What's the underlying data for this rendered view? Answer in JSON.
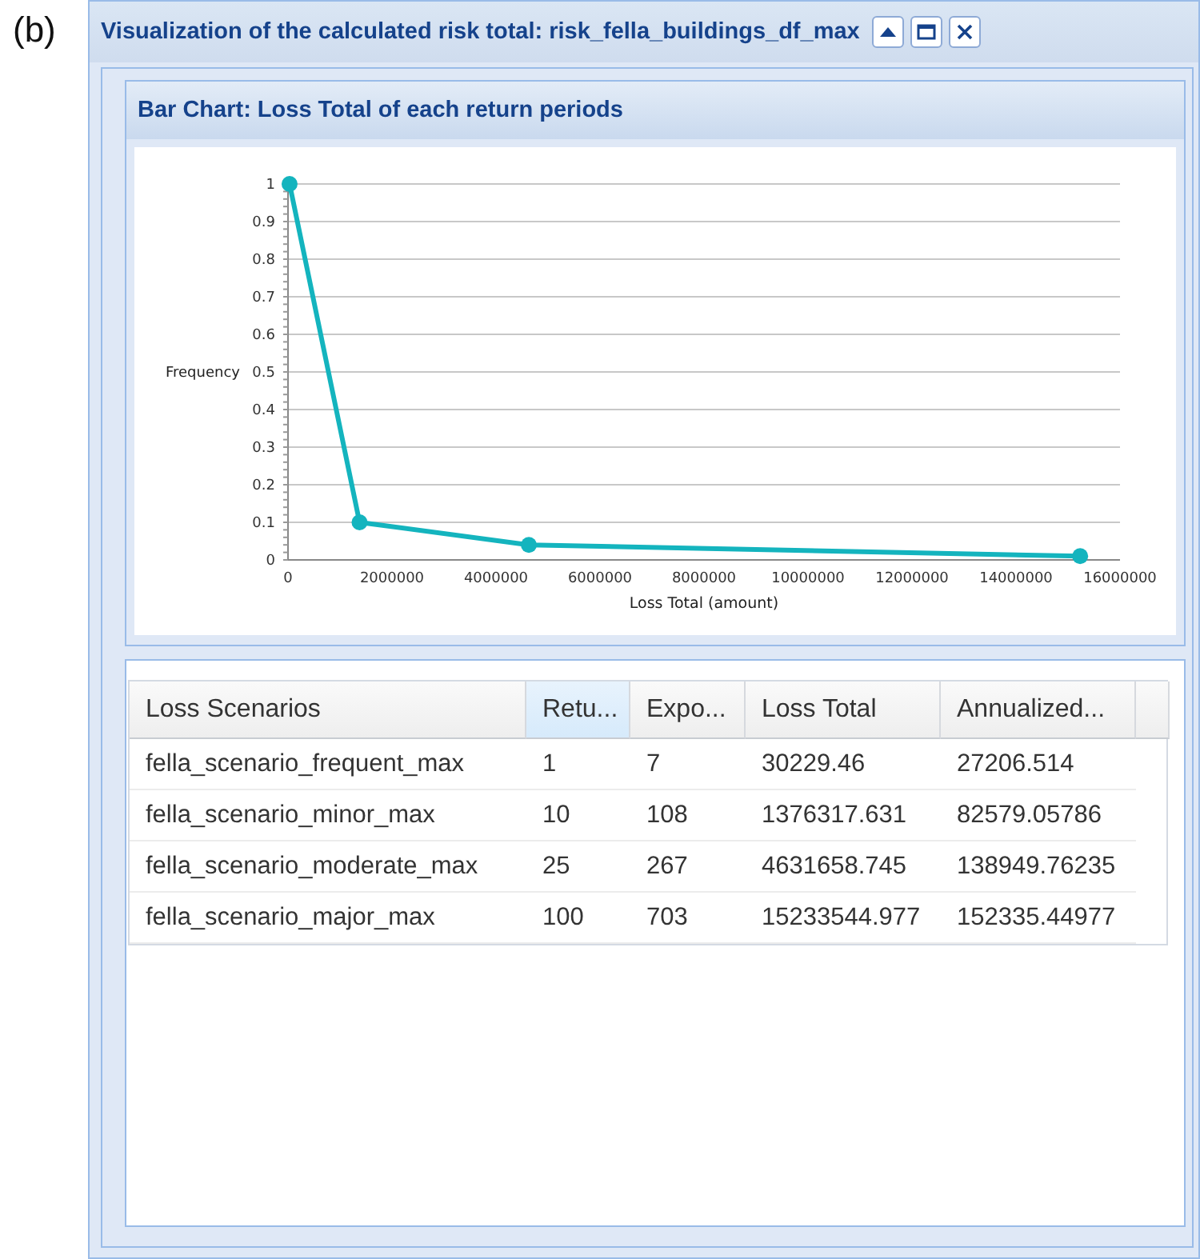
{
  "figure_label": "(b)",
  "window": {
    "title": "Visualization of the calculated risk total: risk_fella_buildings_df_max"
  },
  "chart_panel": {
    "title": "Bar Chart: Loss Total of each return periods",
    "chart_data": {
      "type": "line",
      "xlabel": "Loss Total (amount)",
      "ylabel": "Frequency",
      "x": [
        30229.46,
        1376317.631,
        4631658.745,
        15233544.977
      ],
      "series": [
        {
          "color": "#14b4be",
          "marker": true,
          "values": [
            1,
            0.1,
            0.04,
            0.01
          ]
        }
      ],
      "grid": true,
      "xlim": [
        0,
        16000000
      ],
      "ylim": [
        0,
        1
      ],
      "xticks": [
        0,
        2000000,
        4000000,
        6000000,
        8000000,
        10000000,
        12000000,
        14000000,
        16000000
      ],
      "yticks": [
        0,
        0.1,
        0.2,
        0.3,
        0.4,
        0.5,
        0.6,
        0.7,
        0.8,
        0.9,
        1
      ]
    }
  },
  "table": {
    "columns": [
      {
        "label": "Loss Scenarios",
        "selected": false
      },
      {
        "label": "Retu...",
        "selected": true
      },
      {
        "label": "Expo...",
        "selected": false
      },
      {
        "label": "Loss Total",
        "selected": false
      },
      {
        "label": "Annualized...",
        "selected": false
      }
    ],
    "rows": [
      [
        "fella_scenario_frequent_max",
        "1",
        "7",
        "30229.46",
        "27206.514"
      ],
      [
        "fella_scenario_minor_max",
        "10",
        "108",
        "1376317.631",
        "82579.05786"
      ],
      [
        "fella_scenario_moderate_max",
        "25",
        "267",
        "4631658.745",
        "138949.76235"
      ],
      [
        "fella_scenario_major_max",
        "100",
        "703",
        "15233544.977",
        "152335.44977"
      ]
    ]
  }
}
